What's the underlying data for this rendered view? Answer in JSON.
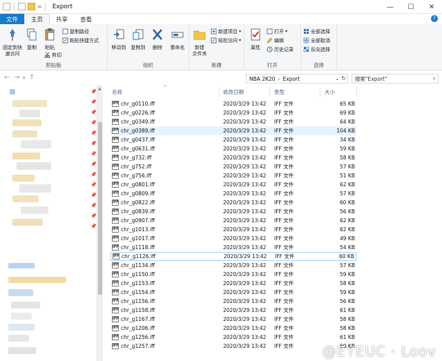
{
  "window": {
    "title": "Export",
    "quick_access_arrow": "=",
    "minimize": "—",
    "maximize": "☐",
    "close": "✕"
  },
  "tabs": [
    "文件",
    "主页",
    "共享",
    "查看"
  ],
  "ribbon": {
    "clipboard": {
      "pin_label": "固定到快\n速访问",
      "copy_label": "复制",
      "paste_label": "粘贴",
      "copy_path_label": "复制路径",
      "paste_shortcut_label": "粘贴快捷方式",
      "cut_label": "剪切",
      "group_label": "剪贴板"
    },
    "organize": {
      "move_to_label": "移动到",
      "copy_to_label": "复制到",
      "delete_label": "删除",
      "rename_label": "重命名",
      "group_label": "组织"
    },
    "new": {
      "new_folder_label": "新建\n文件夹",
      "new_item_label": "新建项目",
      "easy_access_label": "轻松访问",
      "group_label": "新建"
    },
    "open": {
      "properties_label": "属性",
      "open_label": "打开",
      "edit_label": "编辑",
      "history_label": "历史记录",
      "group_label": "打开"
    },
    "select": {
      "select_all_label": "全部选择",
      "select_none_label": "全部取消",
      "invert_label": "反向选择",
      "group_label": "选择"
    }
  },
  "address": {
    "crumbs": [
      "NBA 2K20",
      "Export"
    ],
    "separator": "›",
    "dropdown": "⌄",
    "refresh": "↻",
    "search_placeholder": "搜索\"Export\"",
    "search_icon": "⌕"
  },
  "columns": {
    "name": "名称",
    "date": "修改日期",
    "type": "类型",
    "size": "大小"
  },
  "files": [
    {
      "name": "chr_g0110.iff",
      "date": "2020/3/29 13:42",
      "type": "IFF 文件",
      "size": "65 KB"
    },
    {
      "name": "chr_g0226.iff",
      "date": "2020/3/29 13:42",
      "type": "IFF 文件",
      "size": "69 KB"
    },
    {
      "name": "chr_g0349.iff",
      "date": "2020/3/29 13:42",
      "type": "IFF 文件",
      "size": "64 KB"
    },
    {
      "name": "chr_g0389.iff",
      "date": "2020/3/29 13:42",
      "type": "IFF 文件",
      "size": "104 KB"
    },
    {
      "name": "chr_g0437.iff",
      "date": "2020/3/29 13:42",
      "type": "IFF 文件",
      "size": "34 KB"
    },
    {
      "name": "chr_g0631.iff",
      "date": "2020/3/29 13:42",
      "type": "IFF 文件",
      "size": "59 KB"
    },
    {
      "name": "chr_g732.iff",
      "date": "2020/3/29 13:42",
      "type": "IFF 文件",
      "size": "58 KB"
    },
    {
      "name": "chr_g752.iff",
      "date": "2020/3/29 13:42",
      "type": "IFF 文件",
      "size": "57 KB"
    },
    {
      "name": "chr_g756.iff",
      "date": "2020/3/29 13:42",
      "type": "IFF 文件",
      "size": "51 KB"
    },
    {
      "name": "chr_g0801.iff",
      "date": "2020/3/29 13:42",
      "type": "IFF 文件",
      "size": "62 KB"
    },
    {
      "name": "chr_g0809.iff",
      "date": "2020/3/29 13:42",
      "type": "IFF 文件",
      "size": "57 KB"
    },
    {
      "name": "chr_g0822.iff",
      "date": "2020/3/29 13:42",
      "type": "IFF 文件",
      "size": "60 KB"
    },
    {
      "name": "chr_g0839.iff",
      "date": "2020/3/29 13:42",
      "type": "IFF 文件",
      "size": "56 KB"
    },
    {
      "name": "chr_g0907.iff",
      "date": "2020/3/29 13:42",
      "type": "IFF 文件",
      "size": "62 KB"
    },
    {
      "name": "chr_g1013.iff",
      "date": "2020/3/29 13:42",
      "type": "IFF 文件",
      "size": "62 KB"
    },
    {
      "name": "chr_g1017.iff",
      "date": "2020/3/29 13:42",
      "type": "IFF 文件",
      "size": "49 KB"
    },
    {
      "name": "chr_g1118.iff",
      "date": "2020/3/29 13:42",
      "type": "IFF 文件",
      "size": "54 KB"
    },
    {
      "name": "chr_g1126.iff",
      "date": "2020/3/29 13:42",
      "type": "IFF 文件",
      "size": "60 KB"
    },
    {
      "name": "chr_g1134.iff",
      "date": "2020/3/29 13:42",
      "type": "IFF 文件",
      "size": "57 KB"
    },
    {
      "name": "chr_g1150.iff",
      "date": "2020/3/29 13:42",
      "type": "IFF 文件",
      "size": "59 KB"
    },
    {
      "name": "chr_g1153.iff",
      "date": "2020/3/29 13:42",
      "type": "IFF 文件",
      "size": "58 KB"
    },
    {
      "name": "chr_g1154.iff",
      "date": "2020/3/29 13:42",
      "type": "IFF 文件",
      "size": "59 KB"
    },
    {
      "name": "chr_g1156.iff",
      "date": "2020/3/29 13:42",
      "type": "IFF 文件",
      "size": "56 KB"
    },
    {
      "name": "chr_g1158.iff",
      "date": "2020/3/29 13:42",
      "type": "IFF 文件",
      "size": "61 KB"
    },
    {
      "name": "chr_g1167.iff",
      "date": "2020/3/29 13:42",
      "type": "IFF 文件",
      "size": "58 KB"
    },
    {
      "name": "chr_g1206.iff",
      "date": "2020/3/29 13:42",
      "type": "IFF 文件",
      "size": "58 KB"
    },
    {
      "name": "chr_g1256.iff",
      "date": "2020/3/29 13:42",
      "type": "IFF 文件",
      "size": "61 KB"
    },
    {
      "name": "chr_g1257.iff",
      "date": "2020/3/29 13:42",
      "type": "IFF 文件",
      "size": "60 KB"
    }
  ],
  "highlighted_row": 3,
  "focused_row": 17,
  "file_icon_text": "IFF",
  "watermark": "@EYEUC · Loov",
  "colors": {
    "accent": "#1979ca",
    "selection": "#e5f3ff",
    "focus_border": "#99d1ff",
    "folder": "#f3c74c"
  }
}
